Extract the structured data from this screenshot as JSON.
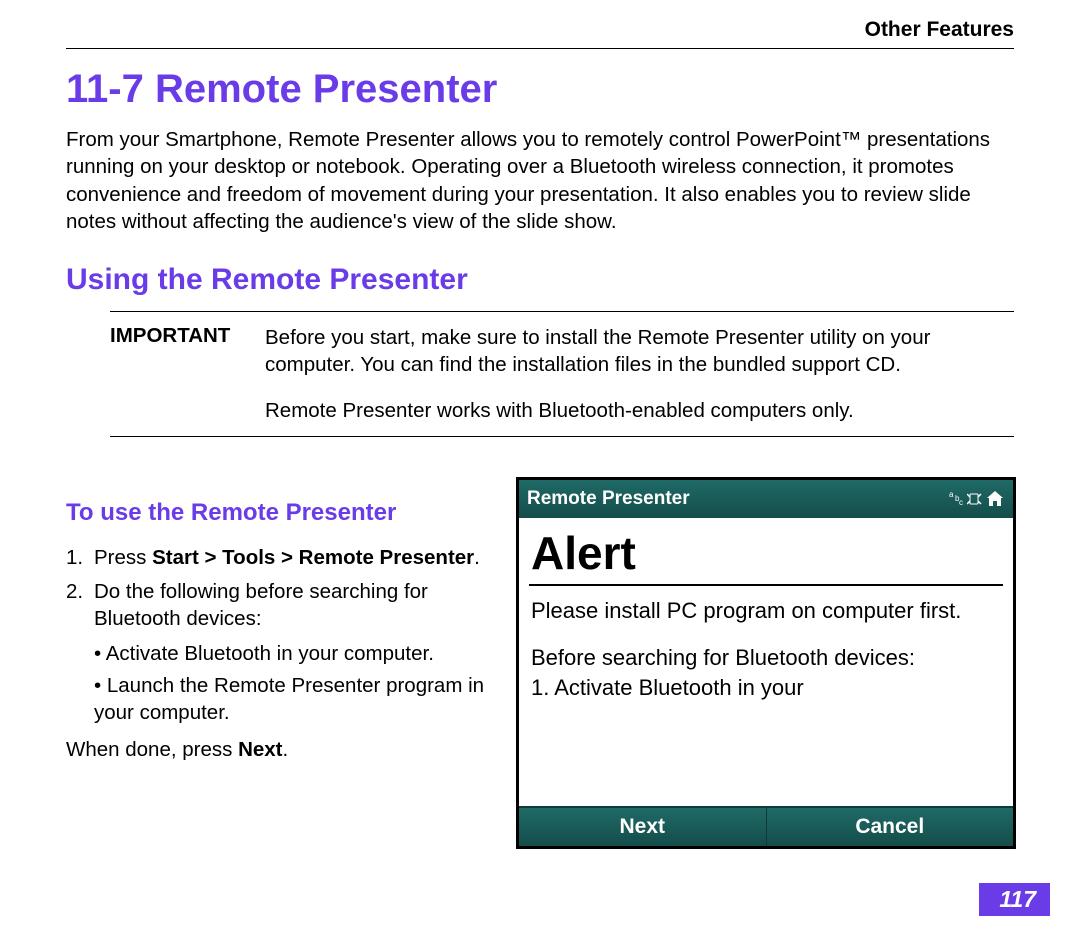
{
  "header": {
    "breadcrumb": "Other Features"
  },
  "section": {
    "number": "11-7",
    "title": "Remote Presenter",
    "intro": "From your Smartphone, Remote Presenter allows you to remotely control PowerPoint™ presentations running on your desktop or notebook. Operating over a Bluetooth wireless connection, it promotes convenience and freedom of movement during your presentation. It also enables you to review slide notes without affecting the audience's view of the slide show."
  },
  "subsection": {
    "title": "Using the Remote Presenter",
    "important_label": "IMPORTANT",
    "important_text": "Before you start, make sure to install the Remote Presenter utility on your computer. You can find the installation files in the bundled support CD.",
    "note2": "Remote Presenter works with Bluetooth-enabled computers only."
  },
  "procedure": {
    "title": "To use the Remote Presenter",
    "step1_prefix": "Press ",
    "step1_bold": "Start > Tools > Remote Presenter",
    "step1_suffix": ".",
    "step2": "Do the following before searching for Bluetooth devices:",
    "bullet1": "• Activate Bluetooth in your computer.",
    "bullet2": "• Launch the Remote Presenter program in your computer.",
    "when_done_prefix": "When done, press ",
    "when_done_bold": "Next",
    "when_done_suffix": "."
  },
  "screenshot": {
    "titlebar": "Remote Presenter",
    "abc": "abc",
    "alert_heading": "Alert",
    "body_p1": "Please install PC program on computer first.",
    "body_p2a": "Before searching for Bluetooth devices:",
    "body_p2b": "1. Activate Bluetooth in your",
    "softkey_left": "Next",
    "softkey_right": "Cancel"
  },
  "page_number": "117"
}
